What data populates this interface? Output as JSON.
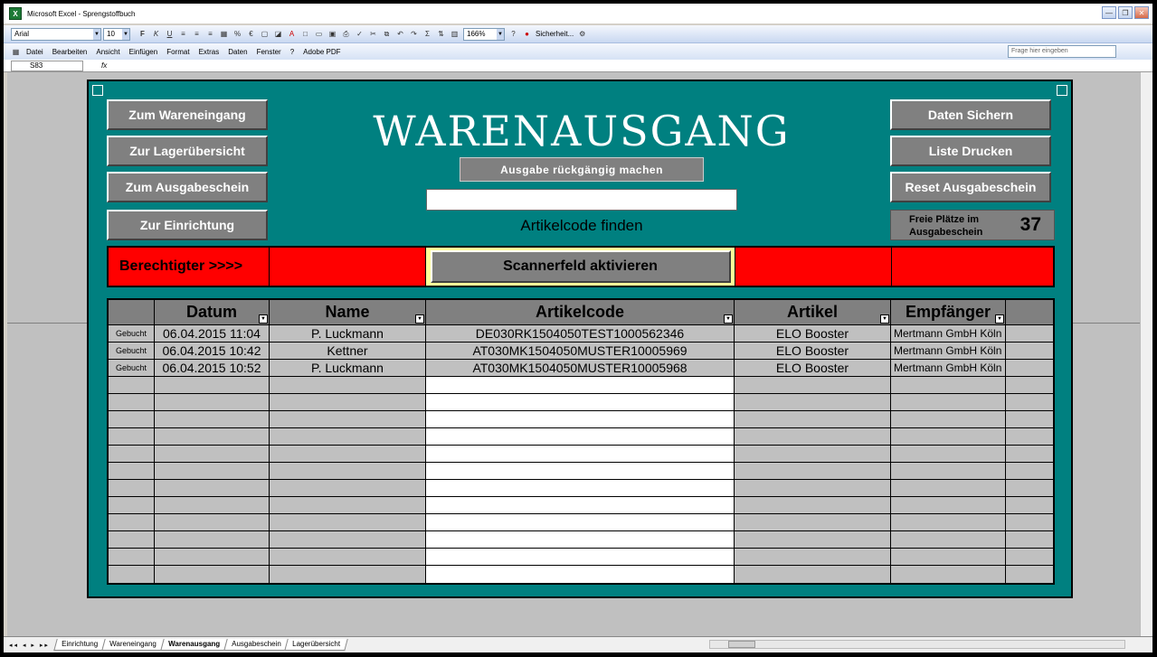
{
  "window": {
    "title": "Microsoft Excel - Sprengstoffbuch",
    "app_icon": "excel-icon"
  },
  "toolbar": {
    "font": "Arial",
    "size": "10",
    "zoom": "166%",
    "security": "Sicherheit..."
  },
  "menu": {
    "items": [
      "Datei",
      "Bearbeiten",
      "Ansicht",
      "Einfügen",
      "Format",
      "Extras",
      "Daten",
      "Fenster",
      "?",
      "Adobe PDF"
    ],
    "help_placeholder": "Frage hier eingeben"
  },
  "formula": {
    "cell_ref": "S83",
    "fx": "fx"
  },
  "form": {
    "title": "WARENAUSGANG",
    "left_buttons": [
      "Zum Wareneingang",
      "Zur Lagerübersicht",
      "Zum Ausgabeschein",
      "Zur Einrichtung"
    ],
    "right_buttons": [
      "Daten Sichern",
      "Liste Drucken",
      "Reset Ausgabeschein"
    ],
    "undo_button": "Ausgabe rückgängig machen",
    "code_label": "Artikelcode finden",
    "free_slots_label": "Freie Plätze im Ausgabeschein",
    "free_slots_value": "37",
    "authorized_label": "Berechtigter >>>>",
    "scan_button": "Scannerfeld aktivieren"
  },
  "table": {
    "headers": [
      "",
      "Datum",
      "Name",
      "Artikelcode",
      "Artikel",
      "Empfänger",
      ""
    ],
    "rows": [
      [
        "Gebucht",
        "06.04.2015 11:04",
        "P. Luckmann",
        "DE030RK1504050TEST1000562346",
        "ELO Booster",
        "Mertmann GmbH Köln",
        ""
      ],
      [
        "Gebucht",
        "06.04.2015 10:42",
        "Kettner",
        "AT030MK1504050MUSTER10005969",
        "ELO Booster",
        "Mertmann GmbH Köln",
        ""
      ],
      [
        "Gebucht",
        "06.04.2015 10:52",
        "P. Luckmann",
        "AT030MK1504050MUSTER10005968",
        "ELO Booster",
        "Mertmann GmbH Köln",
        ""
      ]
    ],
    "empty_rows": 12
  },
  "sheets": {
    "tabs": [
      "Einrichtung",
      "Wareneingang",
      "Warenausgang",
      "Ausgabeschein",
      "Lagerübersicht"
    ],
    "active": "Warenausgang"
  },
  "colors": {
    "panel": "#008080",
    "alert": "#ff0000",
    "button": "#808080",
    "highlight": "#ffff99"
  }
}
